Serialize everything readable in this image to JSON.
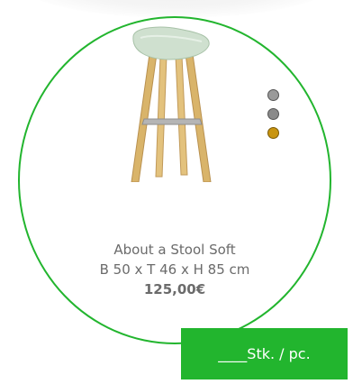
{
  "product": {
    "name": "About a Stool Soft",
    "dimensions": "B 50 x T 46 x H 85 cm",
    "price": "125,00€"
  },
  "color_options": [
    {
      "name": "grey",
      "color": "#9a9a9a"
    },
    {
      "name": "dark-grey",
      "color": "#8a8a8a"
    },
    {
      "name": "mustard",
      "color": "#c8940f"
    }
  ],
  "quantity": {
    "blank": "____",
    "unit_label": "Stk. / pc."
  },
  "colors": {
    "accent": "#22b52e",
    "text": "#6b6b6b"
  }
}
